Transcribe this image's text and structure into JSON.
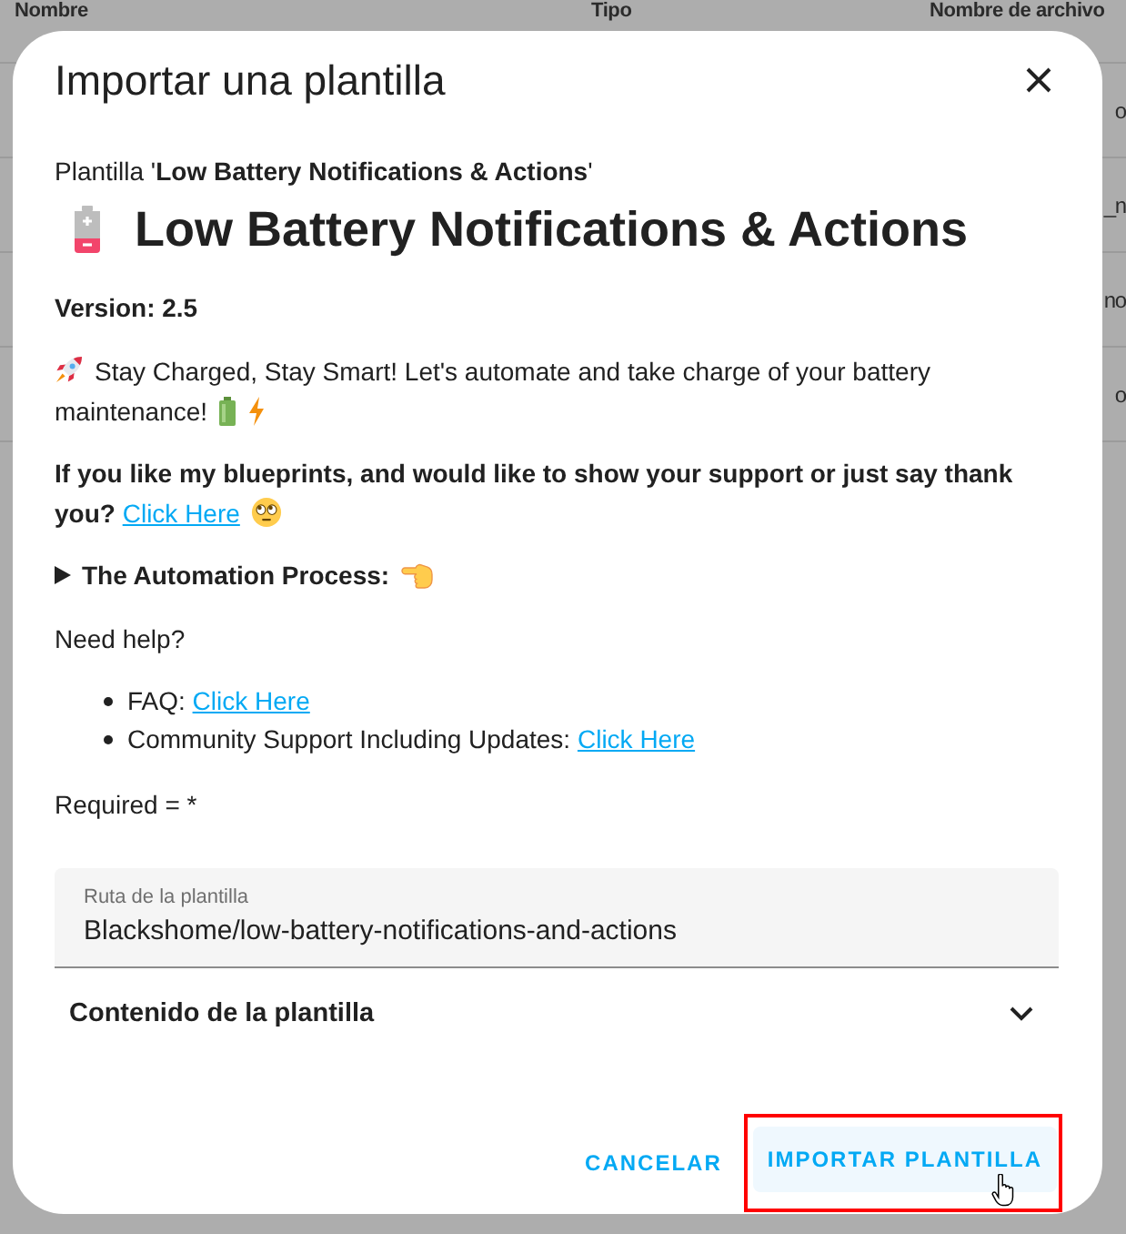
{
  "background_table": {
    "columns": [
      "Nombre",
      "Tipo",
      "Nombre de archivo"
    ],
    "rows": [
      {
        "column_3": "o"
      },
      {
        "column_3": "_n"
      },
      {
        "column_3": "no"
      },
      {
        "column_3": "o"
      }
    ]
  },
  "dialog": {
    "title": "Importar una plantilla",
    "subtitle": "Plantilla '**Low Battery Notifications & Actions**'",
    "heading": "Low Battery Notifications & Actions",
    "version": "Version: 2.5",
    "description": "Stay Charged, Stay Smart! Let's automate and take charge of your battery maintenance!",
    "support": {
      "text": "If you like my blueprints, and would like to show your support or just say thank you?",
      "link": "Click Here"
    },
    "details": {
      "label": "The Automation Process:",
      "expanded": false
    },
    "help_heading": "Need help?",
    "help_links": [
      {
        "label": "FAQ:",
        "link": "Click Here"
      },
      {
        "label": "Community Support Including Updates:",
        "link": "Click Here"
      }
    ],
    "required_note": "Required = *",
    "path_field": {
      "label": "Ruta de la plantilla",
      "value": "Blackshome/low-battery-notifications-and-actions"
    },
    "content_panel": {
      "title": "Contenido de la plantilla",
      "expanded": false
    },
    "buttons": [
      {
        "label": "CANCELAR",
        "hovered": false,
        "highlighted": false
      },
      {
        "label": "IMPORTAR PLANTILLA",
        "hovered": true,
        "highlighted": true
      }
    ]
  }
}
